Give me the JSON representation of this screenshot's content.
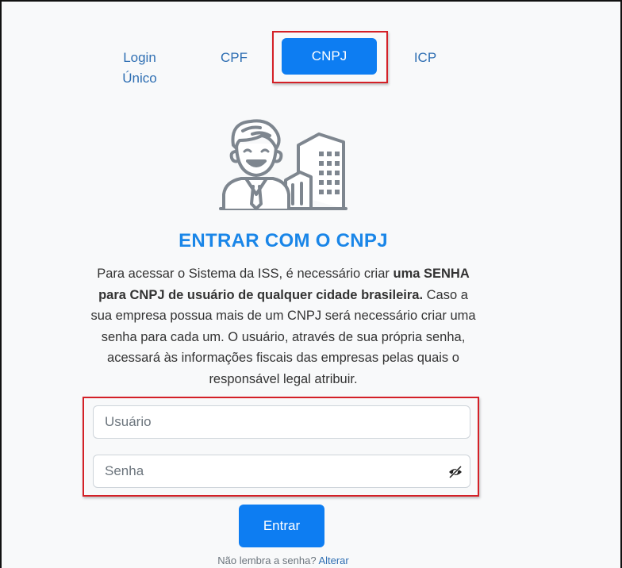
{
  "tabs": {
    "login_line1": "Login",
    "login_line2": "Único",
    "cpf": "CPF",
    "cnpj": "CNPJ",
    "icp": "ICP"
  },
  "title": "ENTRAR COM O CNPJ",
  "description": {
    "part1": "Para acessar o Sistema da ISS, é necessário criar ",
    "bold": "uma SENHA para CNPJ de usuário de qualquer cidade brasileira.",
    "part2": " Caso a sua empresa possua mais de um CNPJ será necessário criar uma senha para cada um. O usuário, através de sua própria senha, acessará às informações fiscais das empresas pelas quais o responsável legal atribuir."
  },
  "form": {
    "user_placeholder": "Usuário",
    "password_placeholder": "Senha",
    "submit_label": "Entrar"
  },
  "forgot": {
    "text": "Não lembra a senha? ",
    "link": "Alterar"
  },
  "colors": {
    "primary": "#0d7df2",
    "title": "#1a86e8",
    "highlight": "#d42027"
  },
  "icons": [
    "person-building-illustration",
    "eye-slash-icon"
  ]
}
